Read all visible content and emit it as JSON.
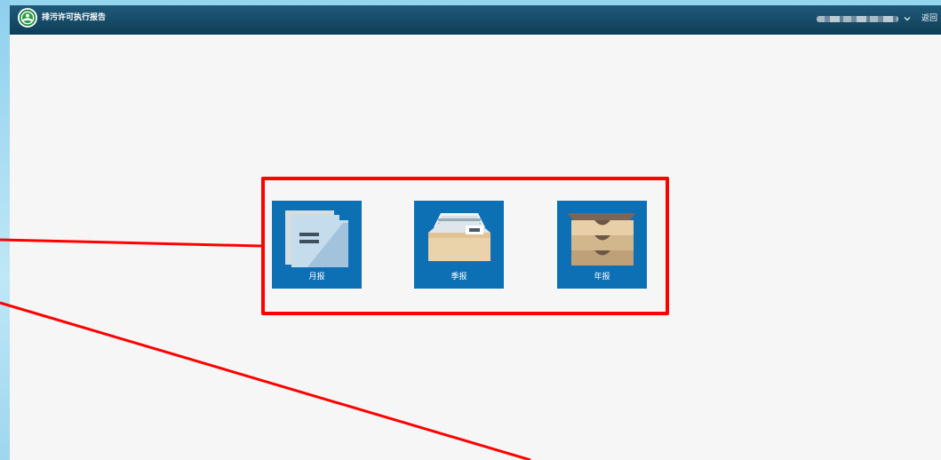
{
  "header": {
    "title": "排污许可执行报告",
    "back_label": "返回",
    "logo_icon": "environmental-protection-emblem-icon",
    "user_dropdown_icon": "chevron-down-icon"
  },
  "reports": [
    {
      "label": "月报",
      "icon": "folder-icon"
    },
    {
      "label": "季报",
      "icon": "file-tray-icon"
    },
    {
      "label": "年报",
      "icon": "drawer-cabinet-icon"
    }
  ],
  "colors": {
    "header_bg": "#14506e",
    "tile_bg": "#0d70b5",
    "annotation_red": "#ff0000",
    "page_bg": "#f6f6f6"
  }
}
